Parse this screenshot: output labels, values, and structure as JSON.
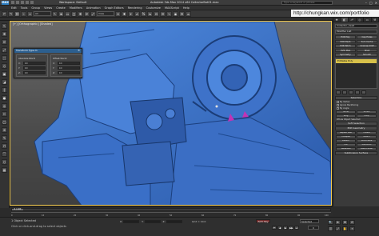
{
  "titlebar": {
    "logo": "MAX",
    "workspace": "Workspace: Default",
    "document": "Autodesk 3ds Max 2014 x64    CollectorBot01.max",
    "search_placeholder": "Type a keyword or phrase",
    "window_controls": [
      "–",
      "□",
      "✕"
    ]
  },
  "watermark": "http://chungkan.wix.com/portfolio",
  "menu": [
    "Edit",
    "Tools",
    "Group",
    "Views",
    "Create",
    "Modifiers",
    "Animation",
    "Graph Editors",
    "Rendering",
    "Customize",
    "MAXScript",
    "Help"
  ],
  "toolbar": {
    "selection_filter": "All",
    "view_dropdown": "View"
  },
  "viewport": {
    "label": "[+] [Orthographic] [Shaded]",
    "model_color": "#3f74c9"
  },
  "dialog": {
    "title": "Transform Type-In",
    "close": "✕",
    "groups": [
      {
        "title": "Absolute:World",
        "fields": [
          {
            "axis": "X:",
            "value": "0.0"
          },
          {
            "axis": "Y:",
            "value": "0.0"
          },
          {
            "axis": "Z:",
            "value": "0.0"
          }
        ]
      },
      {
        "title": "Offset:World",
        "fields": [
          {
            "axis": "X:",
            "value": "0.0"
          },
          {
            "axis": "Y:",
            "value": "0.0"
          },
          {
            "axis": "Z:",
            "value": "0.0"
          }
        ]
      }
    ]
  },
  "command_panel": {
    "tabs": [
      "✚",
      "◧",
      "☍",
      "◎",
      "▭",
      "⚒"
    ],
    "object_name": "Collector_head",
    "modifier_list": "Modifier List",
    "modifier_buttons": [
      "Edit Poly",
      "Cap Holes",
      "Edit Mesh",
      "Sym Cache",
      "Edit Patch",
      "Unwrap UVW",
      "UVW Map",
      "Shell",
      "Symmetry",
      "Smooth"
    ],
    "stack_item": "Editable Poly",
    "rollouts": [
      "Selection",
      "Soft Selection",
      "Edit Geometry",
      "Subdivision Surface"
    ],
    "selection_buttons": [
      "Grow",
      "Shrink",
      "Ring",
      "Loop"
    ],
    "checkboxes": [
      "By Vertex",
      "Ignore Backfacing",
      "By Angle"
    ],
    "edit_geometry_buttons": [
      "Repeat Last",
      "Create",
      "Collapse",
      "Attach",
      "Detach",
      "Slice Plane",
      "Cut",
      "MSmooth",
      "Tessellate",
      "Make Planar"
    ],
    "selection_info": "Whole Object Selected"
  },
  "timeline": {
    "slider_label": "0 / 100",
    "ticks": [
      "0",
      "10",
      "20",
      "30",
      "40",
      "50",
      "60",
      "70",
      "80",
      "90",
      "100"
    ]
  },
  "status": {
    "line1": "1 Object Selected",
    "line2": "Click or click-and-drag to select objects",
    "x_label": "X:",
    "y_label": "Y:",
    "z_label": "Z:",
    "x_value": "",
    "y_value": "",
    "z_value": "",
    "grid": "Grid = 10.0",
    "autokey": "Auto Key",
    "selected": "Selected",
    "playback": [
      "⏮",
      "◀",
      "▶",
      "▶▶",
      "⏭"
    ],
    "frame": "0",
    "nav": [
      "🔍",
      "⊕",
      "✥",
      "⟳",
      "◫",
      "⤢",
      "✋",
      "⌖"
    ]
  }
}
